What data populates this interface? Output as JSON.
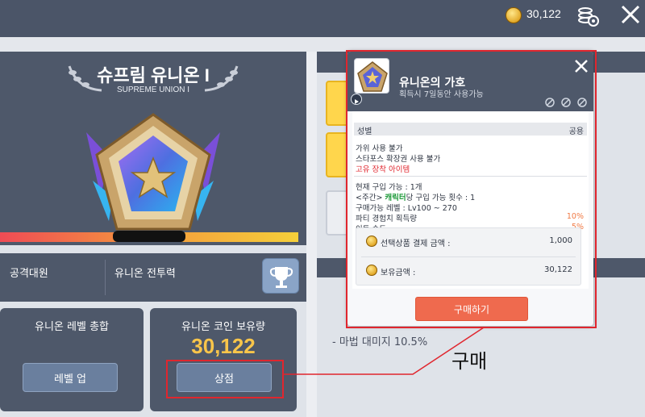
{
  "topbar": {
    "coins": "30,122",
    "coin_icon": "coin-icon",
    "settings_icon": "coins-gear-icon",
    "close_icon": "close-icon"
  },
  "rank": {
    "title": "슈프림 유니온 I",
    "subtitle": "SUPREME UNION I"
  },
  "stats": {
    "attack_team_label": "공격대원",
    "union_power_label": "유니온 전투력"
  },
  "cards": {
    "level_total_title": "유니온 레벨 총합",
    "level_up_label": "레벨 업",
    "coin_title": "유니온 코인 보유량",
    "coin_value": "30,122",
    "shop_label": "상점"
  },
  "background_list": {
    "items": [
      "- 마법 대미지 10.5%"
    ]
  },
  "popup": {
    "title": "유니온의 가호",
    "subtitle": "획득시 7일동안 사용가능",
    "gender_label": "성별",
    "gender_value": "공용",
    "restriction_1": "가위 사용 불가",
    "restriction_2": "스타포스 확장권 사용 불가",
    "unique_equip": "고유 장착 아이템",
    "purchasable_now": "현재 구입 가능 : 1개",
    "weekly_prefix": "<주간> ",
    "weekly_highlight": "캐릭터",
    "weekly_suffix": "당 구입 가능 횟수 : 1",
    "level_range": "구매가능 레벨 : Lv100 ~ 270",
    "party_exp_label": "파티 경험치 획득량",
    "party_exp_value": "10%",
    "move_speed_label": "이동 속도",
    "move_speed_value": "5%",
    "price_label": "선택상품 결제 금액 :",
    "price_value": "1,000",
    "owned_label": "보유금액 :",
    "owned_value": "30,122",
    "buy_label": "구매하기"
  },
  "annotation": {
    "label": "구매",
    "color": "#e0262e"
  }
}
